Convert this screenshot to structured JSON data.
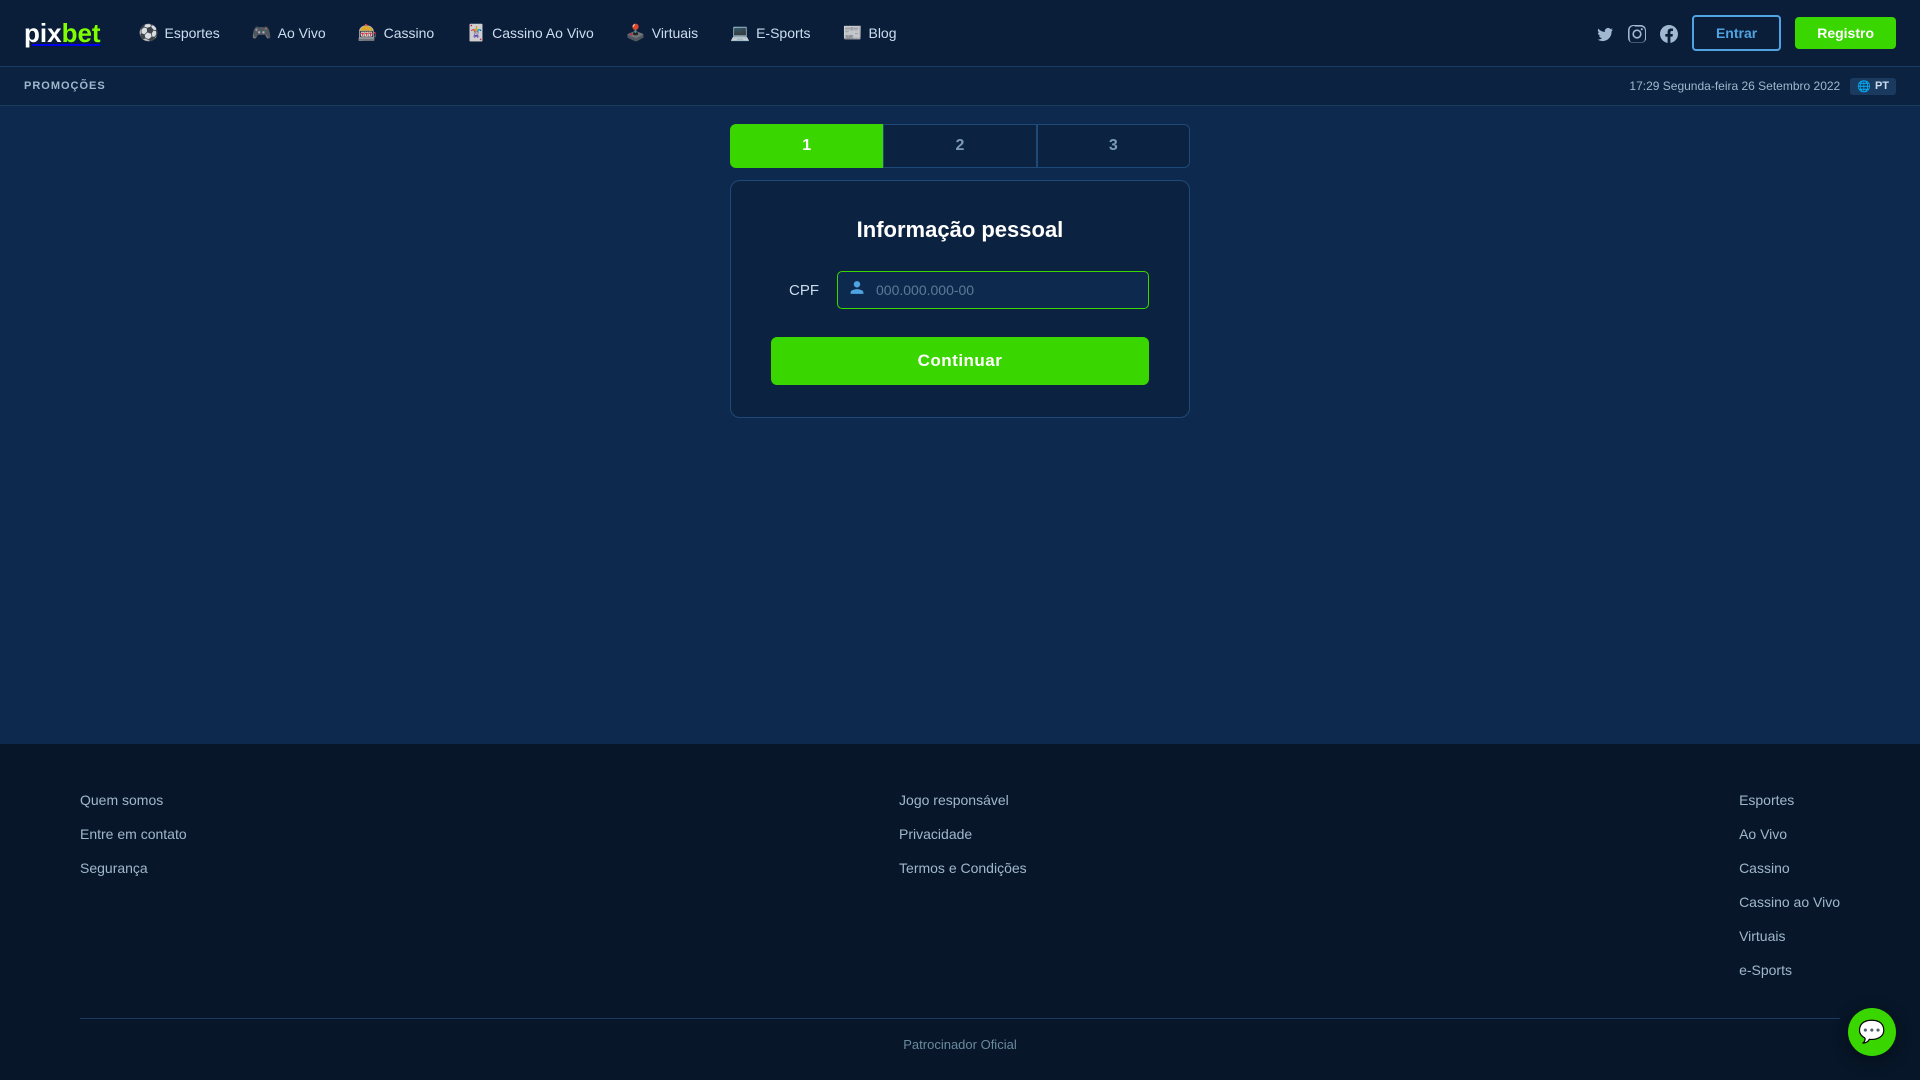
{
  "header": {
    "logo_pix": "pix",
    "logo_bet": "bet",
    "nav": [
      {
        "id": "esportes",
        "label": "Esportes",
        "icon": "⚽"
      },
      {
        "id": "ao-vivo",
        "label": "Ao Vivo",
        "icon": "🎮"
      },
      {
        "id": "cassino",
        "label": "Cassino",
        "icon": "🎰"
      },
      {
        "id": "cassino-ao-vivo",
        "label": "Cassino Ao Vivo",
        "icon": "🃏"
      },
      {
        "id": "virtuais",
        "label": "Virtuais",
        "icon": "🕹️"
      },
      {
        "id": "e-sports",
        "label": "E-Sports",
        "icon": "💻"
      },
      {
        "id": "blog",
        "label": "Blog",
        "icon": "📰"
      }
    ],
    "entrar_label": "Entrar",
    "registro_label": "Registro"
  },
  "promo_bar": {
    "label": "PROMOÇÕES",
    "datetime": "17:29 Segunda-feira 26 Setembro 2022",
    "lang": "PT"
  },
  "steps": [
    {
      "number": "1",
      "active": true
    },
    {
      "number": "2",
      "active": false
    },
    {
      "number": "3",
      "active": false
    }
  ],
  "form": {
    "title": "Informação pessoal",
    "cpf_label": "CPF",
    "cpf_placeholder": "000.000.000-00",
    "continuar_label": "Continuar"
  },
  "footer": {
    "col1": [
      {
        "label": "Quem somos"
      },
      {
        "label": "Entre em contato"
      },
      {
        "label": "Segurança"
      }
    ],
    "col2": [
      {
        "label": "Jogo responsável"
      },
      {
        "label": "Privacidade"
      },
      {
        "label": "Termos e Condições"
      }
    ],
    "col3": [
      {
        "label": "Esportes"
      },
      {
        "label": "Ao Vivo"
      },
      {
        "label": "Cassino"
      },
      {
        "label": "Cassino ao Vivo"
      },
      {
        "label": "Virtuais"
      },
      {
        "label": "e-Sports"
      }
    ],
    "bottom": "Patrocinador Oficial"
  },
  "colors": {
    "accent_green": "#39d600",
    "primary_blue": "#0a1e3a",
    "mid_blue": "#0c2241",
    "dark_bg": "#0d2a4e"
  }
}
